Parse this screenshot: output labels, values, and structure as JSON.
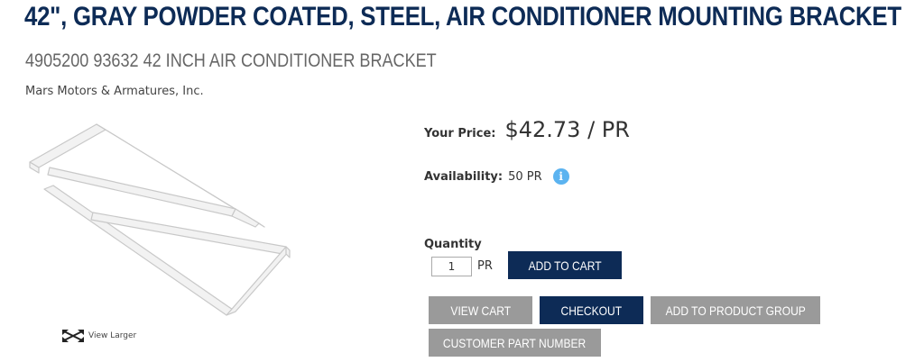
{
  "product": {
    "title": "42\", GRAY POWDER COATED, STEEL, AIR CONDITIONER MOUNTING BRACKET",
    "subtitle": "4905200 93632 42 INCH AIR CONDITIONER BRACKET",
    "vendor": "Mars Motors & Armatures, Inc."
  },
  "image": {
    "view_larger_label": "View Larger",
    "icon": "expand-arrows-icon"
  },
  "pricing": {
    "price_label": "Your Price:",
    "price_value": "$42.73 / PR"
  },
  "availability": {
    "label": "Availability:",
    "value": "50 PR",
    "info_icon_glyph": "i",
    "info_icon_color": "#5bb3f0"
  },
  "quantity": {
    "label": "Quantity",
    "value": "1",
    "unit": "PR"
  },
  "buttons": {
    "add_to_cart": "ADD TO CART",
    "view_cart": "VIEW CART",
    "checkout": "CHECKOUT",
    "add_to_product_group": "ADD TO PRODUCT GROUP",
    "customer_part_number": "CUSTOMER PART NUMBER"
  },
  "colors": {
    "brand_navy": "#0d2b56",
    "button_gray": "#9a9a9a"
  }
}
